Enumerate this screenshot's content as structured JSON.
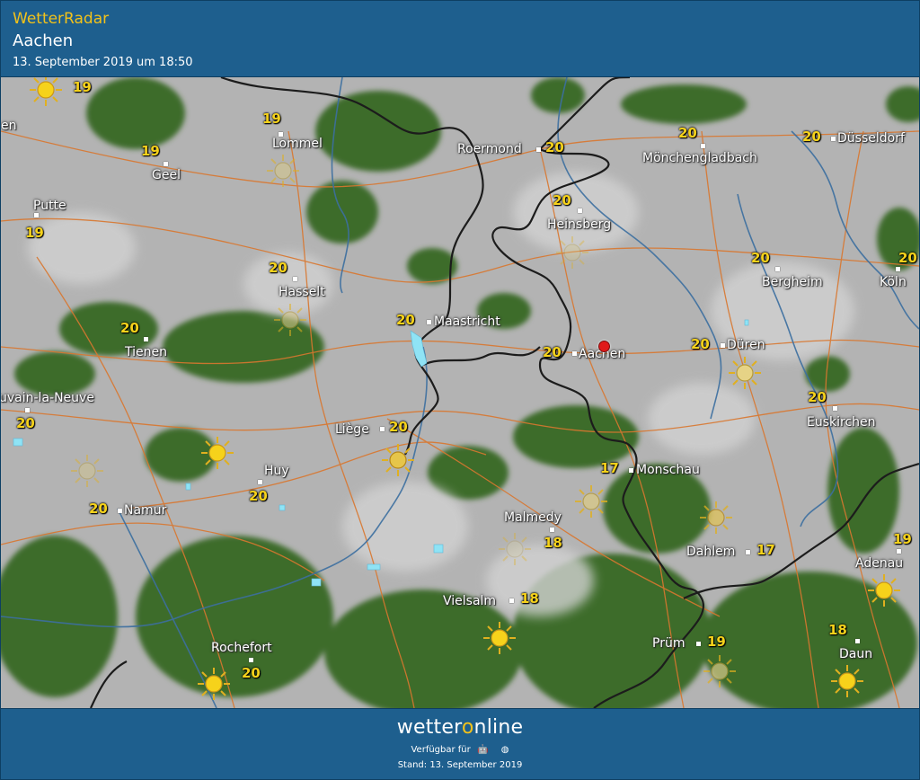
{
  "header": {
    "brand": "WetterRadar",
    "city": "Aachen",
    "timestamp": "13. September 2019 um 18:50"
  },
  "colors": {
    "header_bg": "#1e5f8e",
    "brand_yellow": "#f2c21a",
    "forest_green": "#3e6e2c",
    "cloud_gray": "#b4b4b4",
    "border_line": "#1c1c1c",
    "road_line": "#d9772f",
    "river_line": "#3c6fa0",
    "radar_rain": "#8fe3f5",
    "marker_red": "#e01a1a"
  },
  "map": {
    "towns": [
      {
        "name": "en"
      },
      {
        "name": "Lommel",
        "temp": "19"
      },
      {
        "name": "Geel",
        "temp": "19"
      },
      {
        "name": "Putte",
        "temp": "19"
      },
      {
        "name": "Roermond",
        "temp": "20"
      },
      {
        "name": "Mönchengladbach",
        "temp": "20"
      },
      {
        "name": "Düsseldorf",
        "temp": "20"
      },
      {
        "name": "Heinsberg",
        "temp": "20"
      },
      {
        "name": "Hasselt",
        "temp": "20"
      },
      {
        "name": "Maastricht",
        "temp": "20"
      },
      {
        "name": "Bergheim",
        "temp": "20"
      },
      {
        "name": "Köln",
        "temp": "20"
      },
      {
        "name": "Tienen",
        "temp": "20"
      },
      {
        "name": "Aachen",
        "temp": "20"
      },
      {
        "name": "Düren",
        "temp": "20"
      },
      {
        "name": "uvain-la-Neuve",
        "temp": "20"
      },
      {
        "name": "Euskirchen",
        "temp": "20"
      },
      {
        "name": "Liège",
        "temp": "20"
      },
      {
        "name": "Huy",
        "temp": "20"
      },
      {
        "name": "Monschau",
        "temp": "17"
      },
      {
        "name": "Namur",
        "temp": "20"
      },
      {
        "name": "Malmedy",
        "temp": "18"
      },
      {
        "name": "Dahlem",
        "temp": "17"
      },
      {
        "name": "Adenau",
        "temp": "19"
      },
      {
        "name": "Vielsalm",
        "temp": "18"
      },
      {
        "name": "Daun",
        "temp": "18"
      },
      {
        "name": "Prüm",
        "temp": "19"
      },
      {
        "name": "Rochefort",
        "temp": "20"
      }
    ],
    "corner_temp": "19",
    "selected_marker": "location-pin-icon"
  },
  "footer": {
    "logo_prefix": "wetter",
    "logo_o": "o",
    "logo_suffix": "nline",
    "available_label": "Verfügbar für",
    "platform_icons": [
      "android-icon",
      "apple-icon",
      "web-icon"
    ],
    "platform_glyphs": [
      "🤖",
      "",
      "◍"
    ],
    "stand": "Stand: 13. September 2019"
  }
}
